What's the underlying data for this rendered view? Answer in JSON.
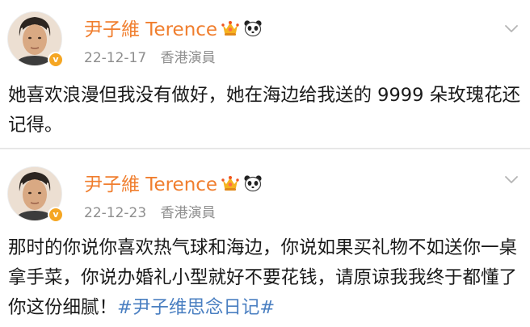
{
  "posts": [
    {
      "user_name": "尹子維 Terence",
      "date": "22-12-17",
      "source": "香港演員",
      "verified_mark": "v",
      "text": "她喜欢浪漫但我没有做好，她在海边给我送的 9999 朵玫瑰花还记得。",
      "hashtag": ""
    },
    {
      "user_name": "尹子維 Terence",
      "date": "22-12-23",
      "source": "香港演員",
      "verified_mark": "v",
      "text": "那时的你说你喜欢热气球和海边，你说如果买礼物不如送你一桌拿手菜，你说办婚礼小型就好不要花钱，请原谅我我终于都懂了你这份细腻！",
      "hashtag": "#尹子维思念日记#"
    }
  ],
  "colors": {
    "name": "#f07e2e",
    "meta": "#8e8e8e",
    "text": "#1a1a1a",
    "hashtag": "#4a7fc1",
    "verified": "#f5a623"
  },
  "icons": {
    "badge_1": "crown-badge-icon",
    "badge_2": "panda-icon",
    "more": "chevron-down-icon",
    "verified": "verified-v-icon"
  }
}
